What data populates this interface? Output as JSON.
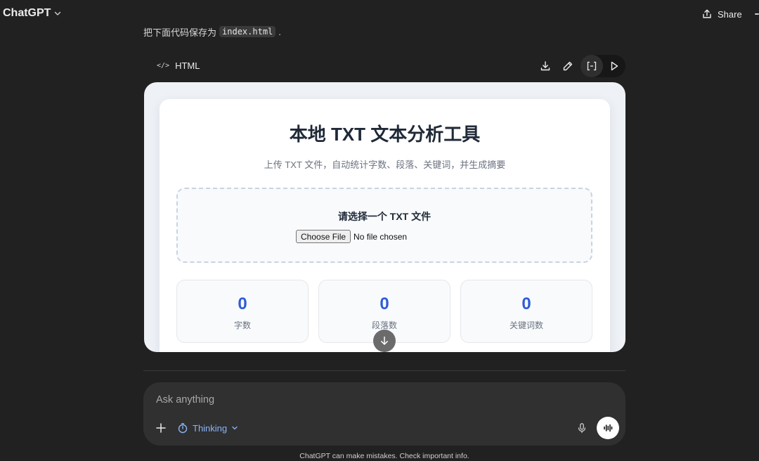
{
  "app": {
    "title": "ChatGPT"
  },
  "header": {
    "share_label": "Share"
  },
  "prev_message": {
    "text_before": "把下面代码保存为",
    "code": "index.html",
    "text_after": "."
  },
  "code_block": {
    "language": "HTML",
    "code_icon": "</>"
  },
  "preview": {
    "title": "本地 TXT 文本分析工具",
    "subtitle": "上传 TXT 文件，自动统计字数、段落、关键词，并生成摘要",
    "upload_label": "请选择一个 TXT 文件",
    "choose_button": "Choose File",
    "no_file_text": "No file chosen",
    "stats": [
      {
        "value": "0",
        "label": "字数"
      },
      {
        "value": "0",
        "label": "段落数"
      },
      {
        "value": "0",
        "label": "关键词数"
      }
    ],
    "colors": {
      "accent": "#2f5bd8"
    }
  },
  "composer": {
    "placeholder": "Ask anything",
    "mode_label": "Thinking"
  },
  "footer": {
    "disclaimer": "ChatGPT can make mistakes. Check important info."
  },
  "icons": {
    "brand_chevron": "chevron-down-icon",
    "share": "share-icon",
    "download": "download-icon",
    "edit": "pencil-icon",
    "code_view": "code-brackets-icon",
    "run": "play-icon",
    "scroll": "arrow-down-icon",
    "plus": "plus-icon",
    "thinking": "timer-icon",
    "mic": "mic-icon",
    "voice": "voice-wave-icon"
  }
}
